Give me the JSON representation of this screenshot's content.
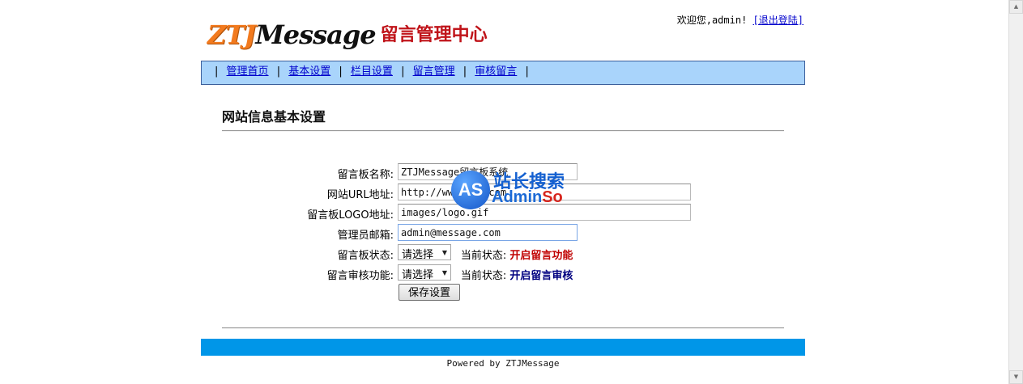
{
  "logo": {
    "brand_ztj": "ZTJ",
    "brand_message": "Message",
    "title_cn": "留言管理中心"
  },
  "userbar": {
    "welcome": "欢迎您,admin!",
    "logout": "[退出登陆]"
  },
  "nav": {
    "items": [
      {
        "label": "管理首页"
      },
      {
        "label": "基本设置"
      },
      {
        "label": "栏目设置"
      },
      {
        "label": "留言管理"
      },
      {
        "label": "审核留言"
      }
    ],
    "separator": "|"
  },
  "page": {
    "title": "网站信息基本设置"
  },
  "form": {
    "board_name": {
      "label": "留言板名称:",
      "value": "ZTJMessage留言板系统"
    },
    "site_url": {
      "label": "网站URL地址:",
      "value": "http://www.ztj.com"
    },
    "logo_url": {
      "label": "留言板LOGO地址:",
      "value": "images/logo.gif"
    },
    "admin_email": {
      "label": "管理员邮箱:",
      "value": "admin@message.com"
    },
    "board_status": {
      "label": "留言板状态:",
      "select": "请选择",
      "current_label": "当前状态:",
      "current_value": "开启留言功能"
    },
    "review_status": {
      "label": "留言审核功能:",
      "select": "请选择",
      "current_label": "当前状态:",
      "current_value": "开启留言审核"
    },
    "save_label": "保存设置"
  },
  "watermark": {
    "badge": "AS",
    "cn": "站长搜索",
    "en_prefix": "Admin",
    "en_suffix": "So"
  },
  "footer": {
    "powered": "Powered by ZTJMessage"
  },
  "colors": {
    "nav_bg": "#a9d4fb",
    "footer_bar": "#0096e8",
    "status_on": "#c00000",
    "review_on": "#000080",
    "logo_orange": "#f27a1e",
    "logo_red": "#c0141a"
  }
}
